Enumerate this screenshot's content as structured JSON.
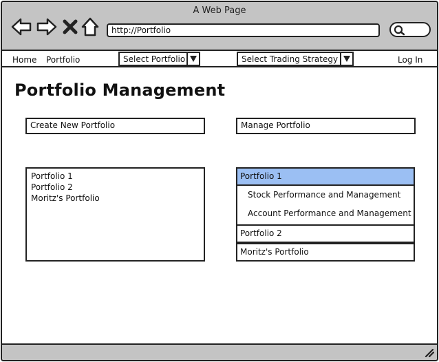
{
  "window": {
    "title": "A Web Page"
  },
  "browser": {
    "url": "http://Portfolio"
  },
  "menu": {
    "home": "Home",
    "portfolio": "Portfolio",
    "select_portfolio": "Select Portfolio",
    "select_strategy": "Select Trading Strategy",
    "login": "Log In"
  },
  "page": {
    "title": "Portfolio Management"
  },
  "buttons": {
    "create": "Create New Portfolio",
    "manage": "Manage Portfolio"
  },
  "portfolio_list": [
    "Portfolio 1",
    "Portfolio 2",
    "Moritz's Portfolio"
  ],
  "accordion": {
    "items": [
      {
        "label": "Portfolio 1",
        "expanded": true,
        "children": [
          "Stock Performance and Management",
          "Account Performance and Management"
        ]
      },
      {
        "label": "Portfolio 2",
        "expanded": false
      },
      {
        "label": "Moritz's Portfolio",
        "expanded": false
      }
    ],
    "active_color": "#9bbff3"
  },
  "colors": {
    "chrome": "#c4c4c4",
    "border": "#222222"
  }
}
